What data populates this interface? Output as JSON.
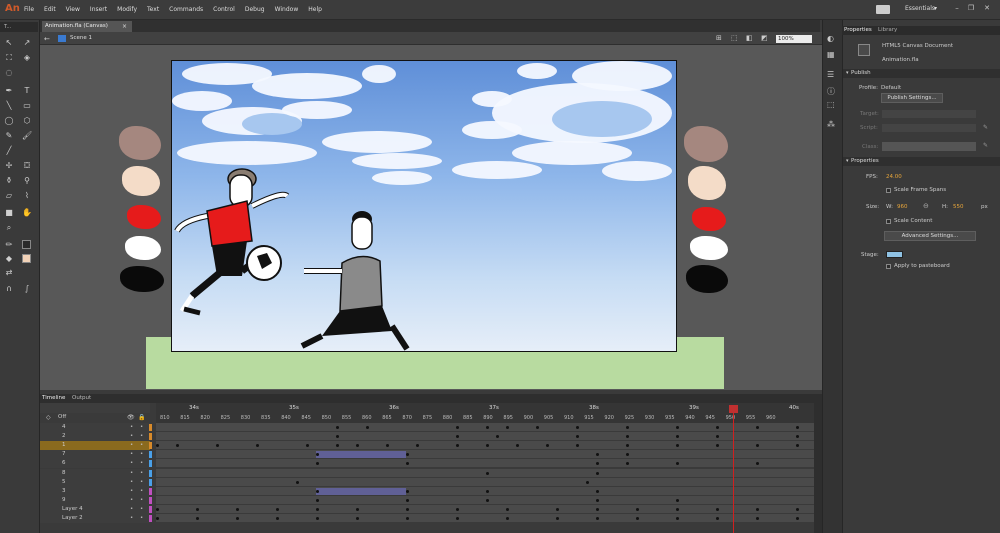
{
  "app": {
    "logo": "An"
  },
  "menu": [
    "File",
    "Edit",
    "View",
    "Insert",
    "Modify",
    "Text",
    "Commands",
    "Control",
    "Debug",
    "Window",
    "Help"
  ],
  "workspace": {
    "label": "Essentials",
    "arrow": "▾"
  },
  "window_controls": [
    "–",
    "❐",
    "✕"
  ],
  "tools_header": "T...",
  "document_tab": {
    "label": "Animation.fla (Canvas)",
    "close": "×"
  },
  "edit_bar": {
    "scene": "Scene 1",
    "zoom": "100%"
  },
  "timeline": {
    "tabs": [
      "Timeline",
      "Output"
    ],
    "onion": "Off",
    "seconds": [
      {
        "label": "34s",
        "pos": 190
      },
      {
        "label": "35s",
        "pos": 290
      },
      {
        "label": "36s",
        "pos": 390
      },
      {
        "label": "37s",
        "pos": 490
      },
      {
        "label": "38s",
        "pos": 590
      },
      {
        "label": "39s",
        "pos": 690
      },
      {
        "label": "40s",
        "pos": 790
      }
    ],
    "frames": [
      "810",
      "815",
      "820",
      "825",
      "830",
      "835",
      "840",
      "845",
      "850",
      "855",
      "860",
      "865",
      "870",
      "875",
      "880",
      "885",
      "890",
      "895",
      "900",
      "905",
      "910",
      "915",
      "920",
      "925",
      "930",
      "935",
      "940",
      "945",
      "950",
      "955",
      "960"
    ],
    "layers": [
      {
        "name": "4",
        "color": "#d88a2a"
      },
      {
        "name": "2",
        "color": "#d88a2a"
      },
      {
        "name": "1",
        "color": "#d88a2a",
        "selected": true
      },
      {
        "name": "7",
        "color": "#4aa0e8"
      },
      {
        "name": "6",
        "color": "#4aa0e8"
      },
      {
        "name": "8",
        "color": "#4aa0e8"
      },
      {
        "name": "5",
        "color": "#4aa0e8"
      },
      {
        "name": "3",
        "color": "#c050c0"
      },
      {
        "name": "9",
        "color": "#c050c0"
      },
      {
        "name": "Layer 4",
        "color": "#c050c0"
      },
      {
        "name": "Layer 2",
        "color": "#c050c0"
      }
    ]
  },
  "properties": {
    "tabs": [
      "Properties",
      "Library"
    ],
    "doc_type": "HTML5 Canvas Document",
    "file": "Animation.fla",
    "publish": {
      "section": "Publish",
      "profile_label": "Profile:",
      "profile_value": "Default",
      "settings_button": "Publish Settings...",
      "target_label": "Target:",
      "script_label": "Script:",
      "class_label": "Class:"
    },
    "props": {
      "section": "Properties",
      "fps_label": "FPS:",
      "fps_value": "24.00",
      "scale_spans": "Scale Frame Spans",
      "size_label": "Size:",
      "w_label": "W:",
      "w_value": "960",
      "h_label": "H:",
      "h_value": "550",
      "unit": "px",
      "scale_content": "Scale Content",
      "advanced_button": "Advanced Settings...",
      "stage_label": "Stage:",
      "stage_color": "#8fc2e4",
      "apply_pasteboard": "Apply to pasteboard"
    }
  },
  "colors": {
    "accent": "#e8a63a",
    "playhead": "#d02020",
    "selected_layer": "#8a6a1e"
  }
}
